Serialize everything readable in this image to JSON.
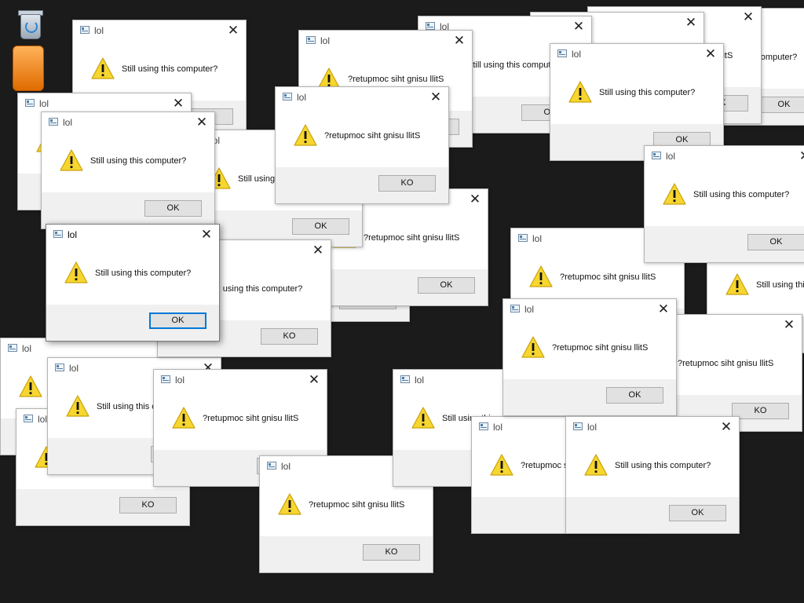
{
  "desktop": {
    "background_color": "#1b1b1b",
    "icons": [
      "recycle-bin-icon",
      "app-shortcut-icon"
    ]
  },
  "dialog": {
    "title": "lol",
    "close_glyph": "✕",
    "icon": "warning-icon",
    "message": "Still using this computer?",
    "message_reversed": "?retupmoc siht gnisu llitS",
    "button_label": "OK",
    "button_label_reversed": "KO"
  },
  "dialogs": [
    {
      "message": "message",
      "button": "button_label"
    },
    {
      "message": "message_reversed",
      "button": "button_label"
    },
    {
      "message": "message_reversed",
      "button": "button_label"
    },
    {
      "message": "message",
      "button": "button_label"
    },
    {
      "message": "message_reversed",
      "button": "button_label_reversed"
    },
    {
      "message": "message",
      "button": "button_label"
    },
    {
      "message": "message",
      "button": "button_label"
    },
    {
      "message": "message",
      "button": "button_label"
    },
    {
      "message": "message_reversed",
      "button": "button_label"
    },
    {
      "message": "message",
      "button": "button_label"
    },
    {
      "message": "message",
      "button": "button_label_reversed"
    },
    {
      "message": "message",
      "button": "button_label_reversed"
    },
    {
      "message": "message",
      "button": "button_label"
    },
    {
      "message": "message",
      "button": "button_label_reversed"
    },
    {
      "message": "message_reversed",
      "button": "button_label_reversed"
    },
    {
      "message": "message_reversed",
      "button": "button_label"
    },
    {
      "message": "message_reversed",
      "button": "button_label_reversed"
    },
    {
      "message": "message",
      "button": "button_label"
    },
    {
      "message": "message_reversed",
      "button": "button_label_reversed"
    },
    {
      "message": "message",
      "button": "button_label"
    },
    {
      "message": "message_reversed",
      "button": "button_label_reversed"
    },
    {
      "message": "message",
      "button": "button_label"
    },
    {
      "message": "message",
      "button": "button_label"
    },
    {
      "message": "message_reversed",
      "button": "button_label_reversed"
    },
    {
      "message": "message",
      "button": "button_label_reversed"
    },
    {
      "message": "message_reversed",
      "button": "button_label"
    },
    {
      "message": "message",
      "button": "button_label"
    },
    {
      "message": "message",
      "button": "button_label",
      "active": true
    }
  ]
}
